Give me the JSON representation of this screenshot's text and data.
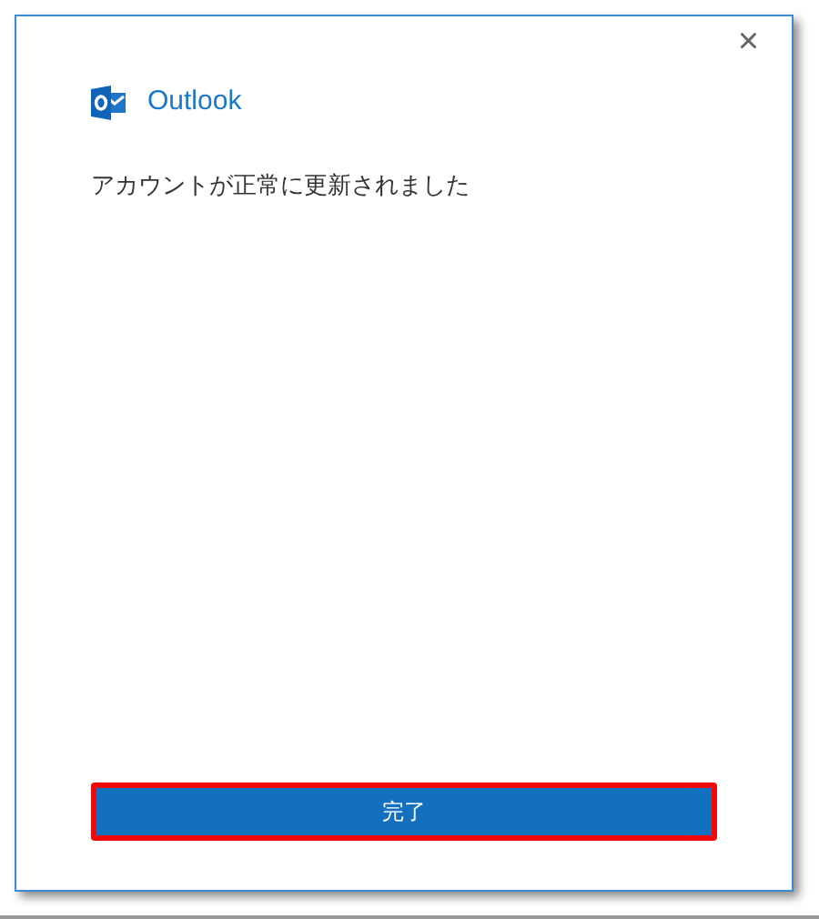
{
  "dialog": {
    "app_name": "Outlook",
    "message": "アカウントが正常に更新されました",
    "close_symbol": "×"
  },
  "button": {
    "label": "完了",
    "highlighted": true
  }
}
